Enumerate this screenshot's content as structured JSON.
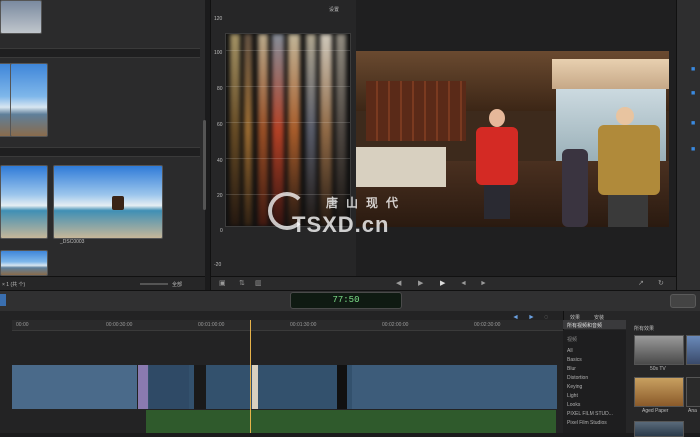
{
  "browser": {
    "clip_label": "_DSC0003",
    "bottom_left_text": "× 1 (共 个)",
    "bottom_right_text": "全部"
  },
  "scope": {
    "scale": [
      "120",
      "100",
      "80",
      "60",
      "40",
      "20",
      "0",
      "-20"
    ],
    "menu_label": "设置"
  },
  "toolbar": {
    "timecode": "77:50"
  },
  "timeline": {
    "ruler": [
      "00:00",
      "00:00:30:00",
      "00:01:00:00",
      "00:01:30:00",
      "00:02:00:00",
      "00:02:30:00"
    ]
  },
  "effects": {
    "header_tab_1": "效果",
    "header_tab_2": "安装",
    "category_selected": "所有视频和音频",
    "category_heading": "视频",
    "categories": [
      "All",
      "Basics",
      "Blur",
      "Distortion",
      "Keying",
      "Light",
      "Looks",
      "PIXEL FILM STUD...",
      "Pixel Film Studios"
    ],
    "preview_heading": "所有效果",
    "thumbs": [
      "50s TV",
      "Aged Paper",
      "Ana"
    ]
  },
  "watermark": {
    "cn_text": "唐山现代",
    "en_text": "TSXD.cn"
  },
  "colors": {
    "accent_timecode": "#7de08a",
    "playhead": "#e6b24a",
    "clip_video": "#33516d",
    "clip_audio": "#2f5a2c"
  }
}
